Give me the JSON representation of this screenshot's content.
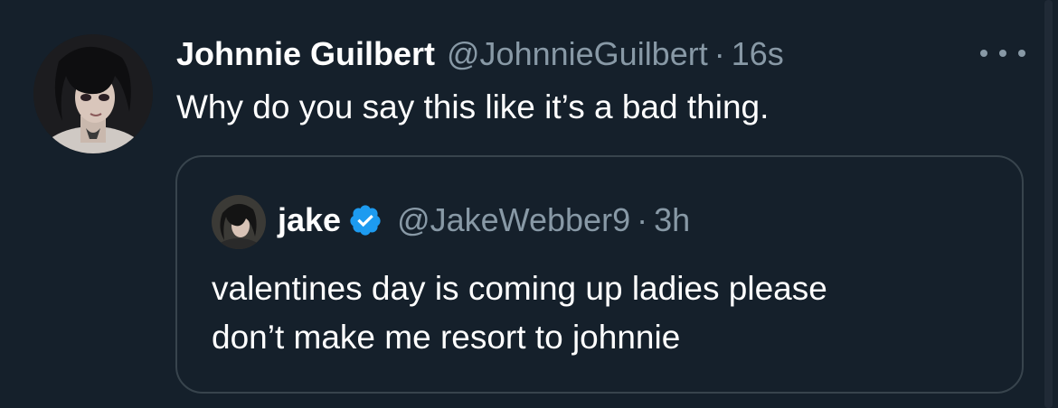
{
  "tweet": {
    "display_name": "Johnnie Guilbert",
    "handle": "@JohnnieGuilbert",
    "separator": "·",
    "time": "16s",
    "text": "Why do you say this like it’s a bad thing.",
    "avatar_icon": "user-avatar",
    "more_icon": "more-horizontal-icon"
  },
  "quoted": {
    "display_name": "jake",
    "verified": true,
    "verified_icon": "verified-badge-icon",
    "handle": "@JakeWebber9",
    "separator": "·",
    "time": "3h",
    "text_lines": [
      "valentines day is coming up ladies please",
      "don’t make me resort to johnnie"
    ]
  },
  "colors": {
    "background": "#15202b",
    "text_primary": "#ffffff",
    "text_secondary": "#8899a6",
    "border": "#38444d",
    "verified": "#1d9bf0"
  }
}
